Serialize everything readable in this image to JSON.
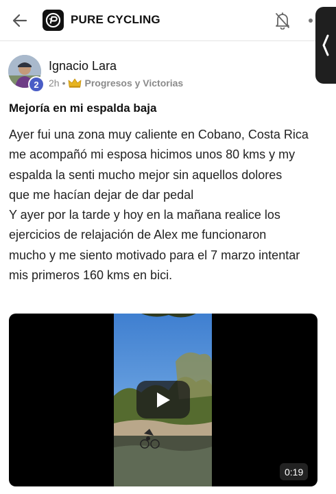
{
  "header": {
    "app_title": "PURE CYCLING",
    "back_icon": "arrow-left-icon",
    "logo_icon": "pure-cycling-logo-icon",
    "bell_icon": "bell-muted-icon",
    "more_icon": "more-vertical-icon",
    "side_tab_icon": "chevron-left-icon"
  },
  "post": {
    "author": "Ignacio Lara",
    "level": "2",
    "time": "2h",
    "separator": "•",
    "category_icon": "crown-icon",
    "category": "Progresos y Victorias",
    "title": "Mejoría en mi espalda baja",
    "body_lines": [
      "Ayer fui una zona muy caliente en Cobano, Costa Rica",
      "me acompañó mi esposa hicimos unos 80 kms y my",
      "espalda la senti mucho mejor sin aquellos dolores",
      "que me hacían dejar de dar pedal",
      "Y ayer por la tarde y hoy en la mañana realice los",
      "ejercicios de relajación de Alex me funcionaron",
      "mucho y me siento motivado para el 7 marzo intentar",
      "mis primeros 160 kms en bici."
    ]
  },
  "video": {
    "duration": "0:19",
    "play_icon": "play-icon"
  },
  "colors": {
    "badge": "#4a5dc6",
    "crown": "#e6b422",
    "divider": "#e3e3e3"
  }
}
